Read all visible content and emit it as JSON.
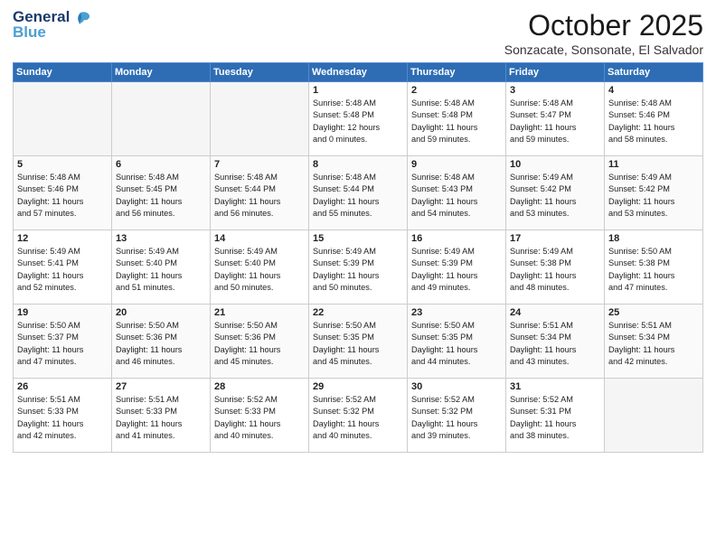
{
  "header": {
    "logo_general": "General",
    "logo_blue": "Blue",
    "month": "October 2025",
    "location": "Sonzacate, Sonsonate, El Salvador"
  },
  "days_of_week": [
    "Sunday",
    "Monday",
    "Tuesday",
    "Wednesday",
    "Thursday",
    "Friday",
    "Saturday"
  ],
  "weeks": [
    [
      {
        "day": "",
        "info": "",
        "empty": true
      },
      {
        "day": "",
        "info": "",
        "empty": true
      },
      {
        "day": "",
        "info": "",
        "empty": true
      },
      {
        "day": "1",
        "info": "Sunrise: 5:48 AM\nSunset: 5:48 PM\nDaylight: 12 hours\nand 0 minutes."
      },
      {
        "day": "2",
        "info": "Sunrise: 5:48 AM\nSunset: 5:48 PM\nDaylight: 11 hours\nand 59 minutes."
      },
      {
        "day": "3",
        "info": "Sunrise: 5:48 AM\nSunset: 5:47 PM\nDaylight: 11 hours\nand 59 minutes."
      },
      {
        "day": "4",
        "info": "Sunrise: 5:48 AM\nSunset: 5:46 PM\nDaylight: 11 hours\nand 58 minutes."
      }
    ],
    [
      {
        "day": "5",
        "info": "Sunrise: 5:48 AM\nSunset: 5:46 PM\nDaylight: 11 hours\nand 57 minutes."
      },
      {
        "day": "6",
        "info": "Sunrise: 5:48 AM\nSunset: 5:45 PM\nDaylight: 11 hours\nand 56 minutes."
      },
      {
        "day": "7",
        "info": "Sunrise: 5:48 AM\nSunset: 5:44 PM\nDaylight: 11 hours\nand 56 minutes."
      },
      {
        "day": "8",
        "info": "Sunrise: 5:48 AM\nSunset: 5:44 PM\nDaylight: 11 hours\nand 55 minutes."
      },
      {
        "day": "9",
        "info": "Sunrise: 5:48 AM\nSunset: 5:43 PM\nDaylight: 11 hours\nand 54 minutes."
      },
      {
        "day": "10",
        "info": "Sunrise: 5:49 AM\nSunset: 5:42 PM\nDaylight: 11 hours\nand 53 minutes."
      },
      {
        "day": "11",
        "info": "Sunrise: 5:49 AM\nSunset: 5:42 PM\nDaylight: 11 hours\nand 53 minutes."
      }
    ],
    [
      {
        "day": "12",
        "info": "Sunrise: 5:49 AM\nSunset: 5:41 PM\nDaylight: 11 hours\nand 52 minutes."
      },
      {
        "day": "13",
        "info": "Sunrise: 5:49 AM\nSunset: 5:40 PM\nDaylight: 11 hours\nand 51 minutes."
      },
      {
        "day": "14",
        "info": "Sunrise: 5:49 AM\nSunset: 5:40 PM\nDaylight: 11 hours\nand 50 minutes."
      },
      {
        "day": "15",
        "info": "Sunrise: 5:49 AM\nSunset: 5:39 PM\nDaylight: 11 hours\nand 50 minutes."
      },
      {
        "day": "16",
        "info": "Sunrise: 5:49 AM\nSunset: 5:39 PM\nDaylight: 11 hours\nand 49 minutes."
      },
      {
        "day": "17",
        "info": "Sunrise: 5:49 AM\nSunset: 5:38 PM\nDaylight: 11 hours\nand 48 minutes."
      },
      {
        "day": "18",
        "info": "Sunrise: 5:50 AM\nSunset: 5:38 PM\nDaylight: 11 hours\nand 47 minutes."
      }
    ],
    [
      {
        "day": "19",
        "info": "Sunrise: 5:50 AM\nSunset: 5:37 PM\nDaylight: 11 hours\nand 47 minutes."
      },
      {
        "day": "20",
        "info": "Sunrise: 5:50 AM\nSunset: 5:36 PM\nDaylight: 11 hours\nand 46 minutes."
      },
      {
        "day": "21",
        "info": "Sunrise: 5:50 AM\nSunset: 5:36 PM\nDaylight: 11 hours\nand 45 minutes."
      },
      {
        "day": "22",
        "info": "Sunrise: 5:50 AM\nSunset: 5:35 PM\nDaylight: 11 hours\nand 45 minutes."
      },
      {
        "day": "23",
        "info": "Sunrise: 5:50 AM\nSunset: 5:35 PM\nDaylight: 11 hours\nand 44 minutes."
      },
      {
        "day": "24",
        "info": "Sunrise: 5:51 AM\nSunset: 5:34 PM\nDaylight: 11 hours\nand 43 minutes."
      },
      {
        "day": "25",
        "info": "Sunrise: 5:51 AM\nSunset: 5:34 PM\nDaylight: 11 hours\nand 42 minutes."
      }
    ],
    [
      {
        "day": "26",
        "info": "Sunrise: 5:51 AM\nSunset: 5:33 PM\nDaylight: 11 hours\nand 42 minutes."
      },
      {
        "day": "27",
        "info": "Sunrise: 5:51 AM\nSunset: 5:33 PM\nDaylight: 11 hours\nand 41 minutes."
      },
      {
        "day": "28",
        "info": "Sunrise: 5:52 AM\nSunset: 5:33 PM\nDaylight: 11 hours\nand 40 minutes."
      },
      {
        "day": "29",
        "info": "Sunrise: 5:52 AM\nSunset: 5:32 PM\nDaylight: 11 hours\nand 40 minutes."
      },
      {
        "day": "30",
        "info": "Sunrise: 5:52 AM\nSunset: 5:32 PM\nDaylight: 11 hours\nand 39 minutes."
      },
      {
        "day": "31",
        "info": "Sunrise: 5:52 AM\nSunset: 5:31 PM\nDaylight: 11 hours\nand 38 minutes."
      },
      {
        "day": "",
        "info": "",
        "empty": true
      }
    ]
  ]
}
